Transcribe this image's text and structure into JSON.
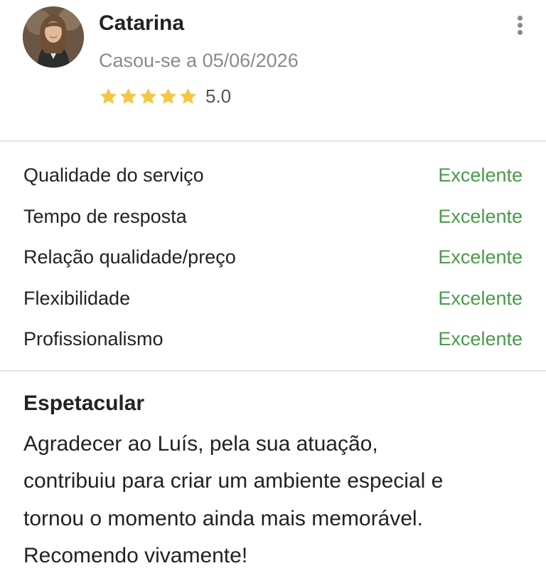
{
  "reviewer": {
    "name": "Catarina",
    "married_text": "Casou-se a 05/06/2026",
    "rating_value": "5.0",
    "stars": 5,
    "star_color": "#f2c744",
    "avatar_icon": "user-photo"
  },
  "menu": {
    "icon": "more-vertical-icon"
  },
  "ratings": [
    {
      "label": "Qualidade do serviço",
      "value": "Excelente"
    },
    {
      "label": "Tempo de resposta",
      "value": "Excelente"
    },
    {
      "label": "Relação qualidade/preço",
      "value": "Excelente"
    },
    {
      "label": "Flexibilidade",
      "value": "Excelente"
    },
    {
      "label": "Profissionalismo",
      "value": "Excelente"
    }
  ],
  "review": {
    "title": "Espetacular",
    "lines": [
      "Agradecer ao Luís, pela sua atuação,",
      "contribuiu para criar um ambiente especial e",
      "tornou o momento ainda mais memorável.",
      "Recomendo vivamente!"
    ]
  },
  "colors": {
    "accent_green": "#4a9a4a",
    "muted_text": "#8a8a8a",
    "divider": "#e3e3e3"
  }
}
